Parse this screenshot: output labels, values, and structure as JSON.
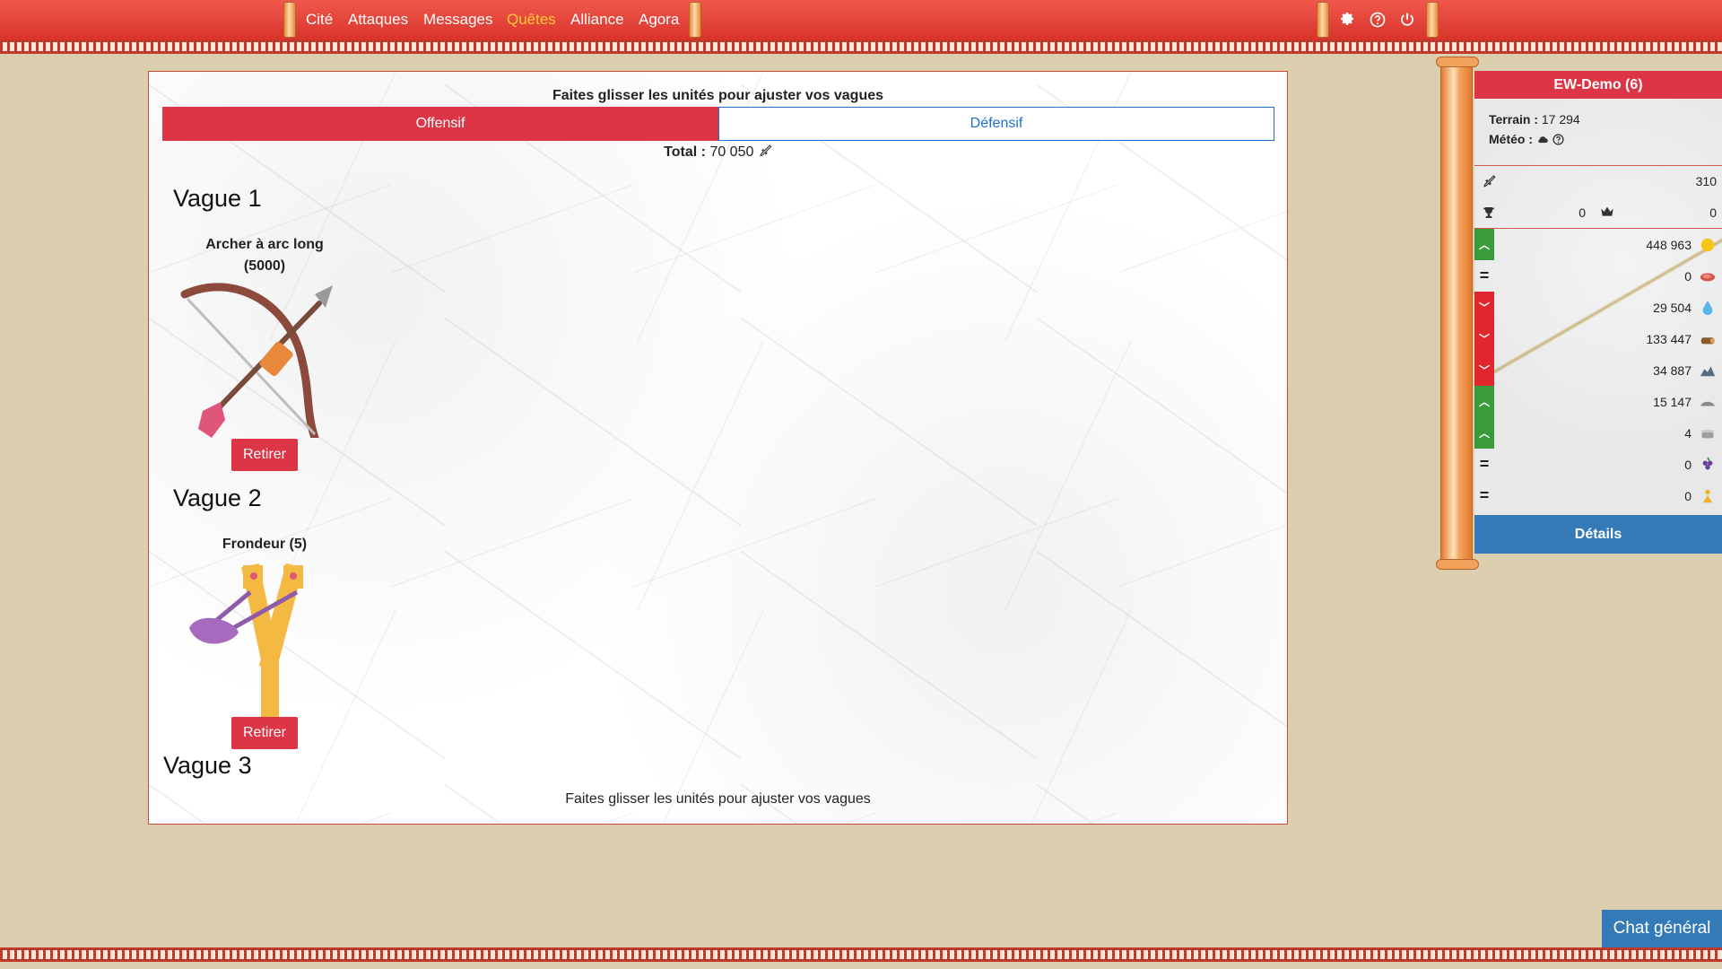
{
  "nav": {
    "items": [
      {
        "label": "Cité"
      },
      {
        "label": "Attaques"
      },
      {
        "label": "Messages"
      },
      {
        "label": "Quêtes"
      },
      {
        "label": "Alliance"
      },
      {
        "label": "Agora"
      }
    ],
    "active": "Quêtes",
    "icons": [
      "gear-icon",
      "help-icon",
      "power-icon"
    ]
  },
  "main": {
    "drag_hint": "Faites glisser les unités pour ajuster vos vagues",
    "tabs": [
      {
        "label": "Offensif",
        "active": true
      },
      {
        "label": "Défensif",
        "active": false
      }
    ],
    "total_label": "Total :",
    "total_value": "70 050",
    "waves": [
      {
        "title": "Vague 1",
        "unit": "Archer à arc long",
        "count": "(5000)",
        "button": "Retirer",
        "icon": "bow-and-arrow"
      },
      {
        "title": "Vague 2",
        "unit": "Frondeur",
        "count": "(5)",
        "button": "Retirer",
        "icon": "slingshot"
      },
      {
        "title": "Vague 3"
      }
    ],
    "drag_hint_bottom": "Faites glisser les unités pour ajuster vos vagues"
  },
  "side": {
    "city_name": "EW-Demo (6)",
    "terrain_label": "Terrain :",
    "terrain_value": "17 294",
    "meteo_label": "Météo :",
    "stats": {
      "attack": "310",
      "trophy": "0",
      "crown": "0"
    },
    "resources": [
      {
        "trend": "up",
        "value": "448 963",
        "icon": "gold-icon",
        "color": "#f5c518"
      },
      {
        "trend": "eq",
        "value": "0",
        "icon": "meat-icon",
        "color": "#d9534f"
      },
      {
        "trend": "down",
        "value": "29 504",
        "icon": "water-icon",
        "color": "#5ab4e8"
      },
      {
        "trend": "down",
        "value": "133 447",
        "icon": "wood-icon",
        "color": "#8b5a2b"
      },
      {
        "trend": "down",
        "value": "34 887",
        "icon": "stone-icon",
        "color": "#5a6b7a"
      },
      {
        "trend": "up",
        "value": "15 147",
        "icon": "iron-icon",
        "color": "#8a8a8a"
      },
      {
        "trend": "up",
        "value": "4",
        "icon": "marble-icon",
        "color": "#a0a0a0"
      },
      {
        "trend": "eq",
        "value": "0",
        "icon": "grape-icon",
        "color": "#6b3fa0"
      },
      {
        "trend": "eq",
        "value": "0",
        "icon": "population-icon",
        "color": "#f0b429"
      }
    ],
    "details_label": "Détails"
  },
  "chat": {
    "label": "Chat général"
  },
  "colors": {
    "topbar": "#e0443a",
    "danger": "#dc3545",
    "primary": "#337ab7",
    "active_nav": "#ffc93a"
  }
}
